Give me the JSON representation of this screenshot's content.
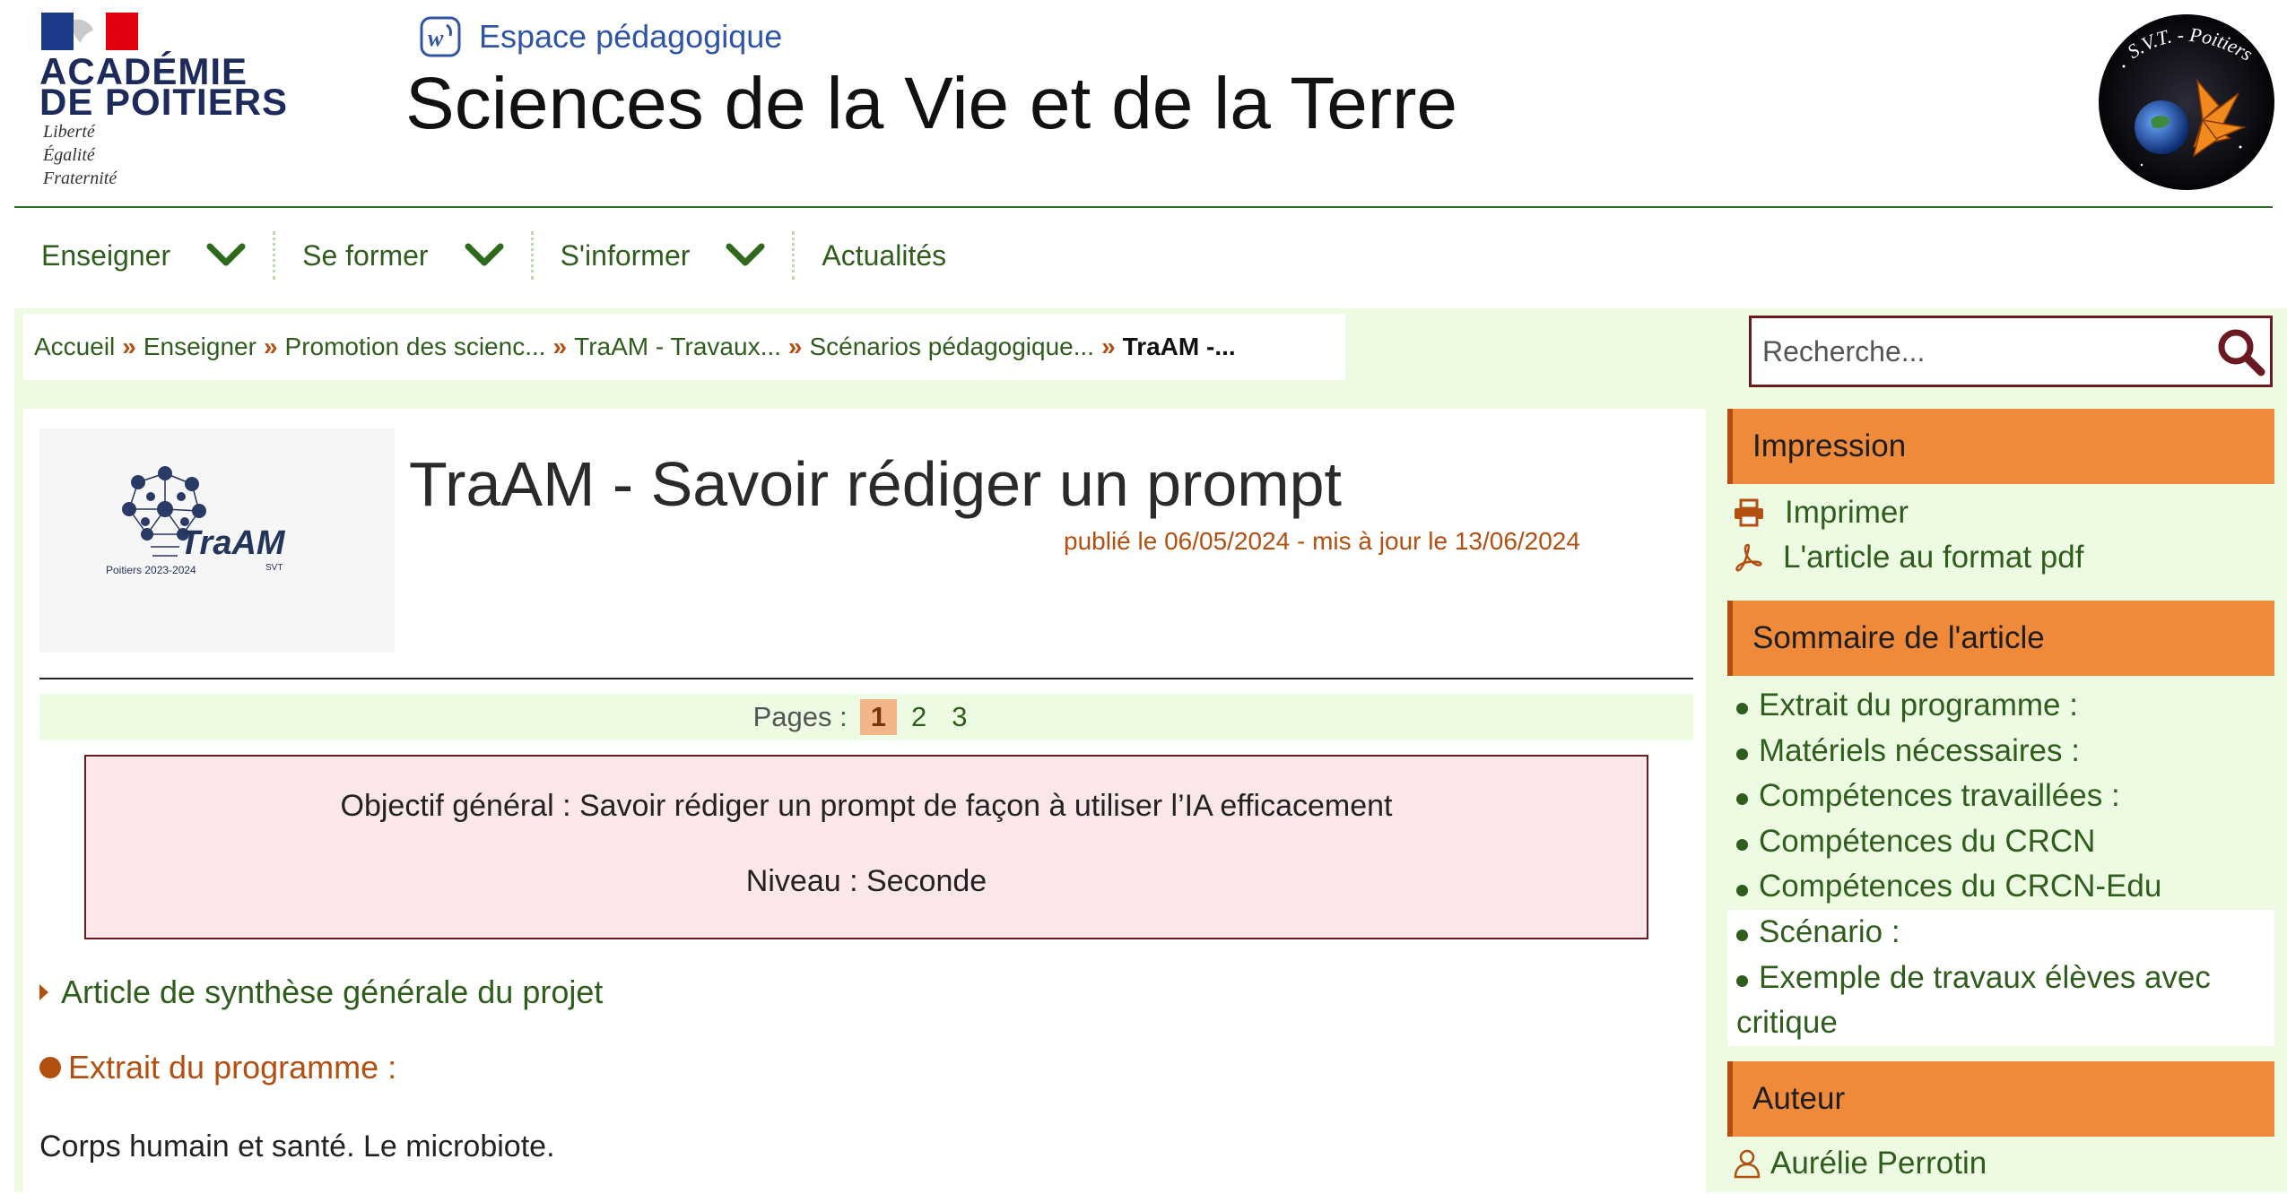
{
  "header": {
    "academie_line1": "ACADÉMIE",
    "academie_line2": "DE POITIERS",
    "devise": [
      "Liberté",
      "Égalité",
      "Fraternité"
    ],
    "espace_label": "Espace pédagogique",
    "site_title": "Sciences de la Vie et de la Terre",
    "svt_logo_text": "S.V.T. - Poitiers"
  },
  "nav": {
    "items": [
      {
        "label": "Enseigner",
        "has_submenu": true
      },
      {
        "label": "Se former",
        "has_submenu": true
      },
      {
        "label": "S'informer",
        "has_submenu": true
      },
      {
        "label": "Actualités",
        "has_submenu": false
      }
    ]
  },
  "breadcrumb": {
    "items": [
      "Accueil",
      "Enseigner",
      "Promotion des scienc...",
      "TraAM - Travaux...",
      "Scénarios pédagogique...",
      "TraAM -..."
    ]
  },
  "search": {
    "placeholder": "Recherche..."
  },
  "article": {
    "logo_text": "TraAM",
    "logo_sub": "SVT",
    "logo_caption": "Poitiers 2023-2024",
    "title": "TraAM - Savoir rédiger un prompt",
    "dates": "publié le 06/05/2024  - mis à jour le 13/06/2024",
    "pages_label": "Pages :",
    "pages": [
      "1",
      "2",
      "3"
    ],
    "current_page": "1",
    "objectif": "Objectif général : Savoir rédiger un prompt de façon à utiliser l’IA efficacement",
    "niveau": "Niveau : Seconde",
    "synthese_link": "Article de synthèse générale du projet",
    "extrait_heading": "Extrait du programme :",
    "corps_text": "Corps humain et santé. Le microbiote."
  },
  "sidebar": {
    "impression": {
      "heading": "Impression",
      "print_label": "Imprimer",
      "pdf_label": "L'article au format pdf"
    },
    "sommaire": {
      "heading": "Sommaire de l'article",
      "items": [
        "Extrait du programme :",
        "Matériels nécessaires :",
        "Compétences travaillées :",
        "Compétences du CRCN",
        "Compétences du CRCN-Edu",
        "Scénario :",
        "Exemple de travaux élèves avec critique"
      ]
    },
    "auteur": {
      "heading": "Auteur",
      "name": "Aurélie Perrotin"
    }
  },
  "colors": {
    "green_link": "#2f5d1c",
    "orange_accent": "#ef8a3a",
    "rust": "#b34f10",
    "pale_green_bg": "#ecfbe2",
    "pink_box": "#fbe6ea",
    "dark_red_border": "#6b1a22",
    "marianne_blue": "#1d2a5c"
  },
  "icons": {
    "nav_chevron": "chevron-down-icon",
    "search": "search-icon",
    "print": "printer-icon",
    "pdf": "pdf-icon",
    "author": "user-icon"
  }
}
